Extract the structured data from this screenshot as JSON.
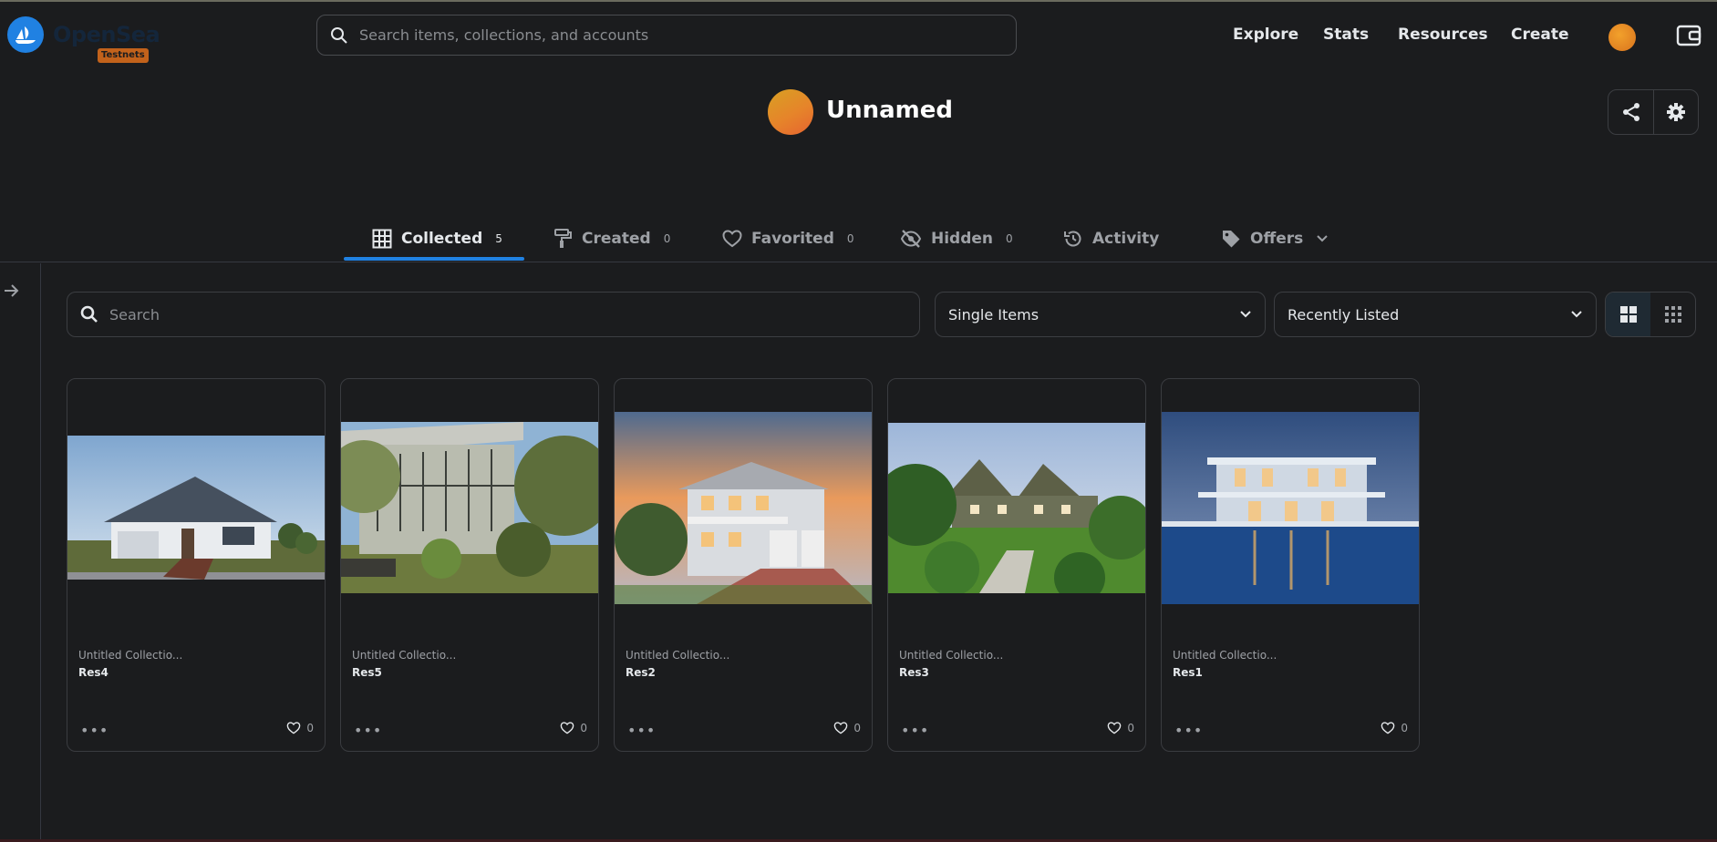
{
  "header": {
    "logo_text": "OpenSea",
    "badge": "Testnets",
    "search_placeholder": "Search items, collections, and accounts",
    "nav": [
      "Explore",
      "Stats",
      "Resources",
      "Create"
    ]
  },
  "profile": {
    "name": "Unnamed"
  },
  "tabs": [
    {
      "label": "Collected",
      "count": "5",
      "icon": "grid-icon",
      "active": true
    },
    {
      "label": "Created",
      "count": "0",
      "icon": "paint-roller-icon"
    },
    {
      "label": "Favorited",
      "count": "0",
      "icon": "heart-icon"
    },
    {
      "label": "Hidden",
      "count": "0",
      "icon": "eye-off-icon"
    },
    {
      "label": "Activity",
      "icon": "history-icon"
    },
    {
      "label": "Offers",
      "icon": "tag-icon"
    }
  ],
  "filters": {
    "search_placeholder": "Search",
    "item_type": "Single Items",
    "sort": "Recently Listed"
  },
  "items": [
    {
      "collection": "Untitled Collectio...",
      "name": "Res4",
      "likes": "0"
    },
    {
      "collection": "Untitled Collectio...",
      "name": "Res5",
      "likes": "0"
    },
    {
      "collection": "Untitled Collectio...",
      "name": "Res2",
      "likes": "0"
    },
    {
      "collection": "Untitled Collectio...",
      "name": "Res3",
      "likes": "0"
    },
    {
      "collection": "Untitled Collectio...",
      "name": "Res1",
      "likes": "0"
    }
  ],
  "colors": {
    "accent": "#2081e2",
    "background": "#1b1c1e",
    "testnets_badge": "#c2621b"
  }
}
